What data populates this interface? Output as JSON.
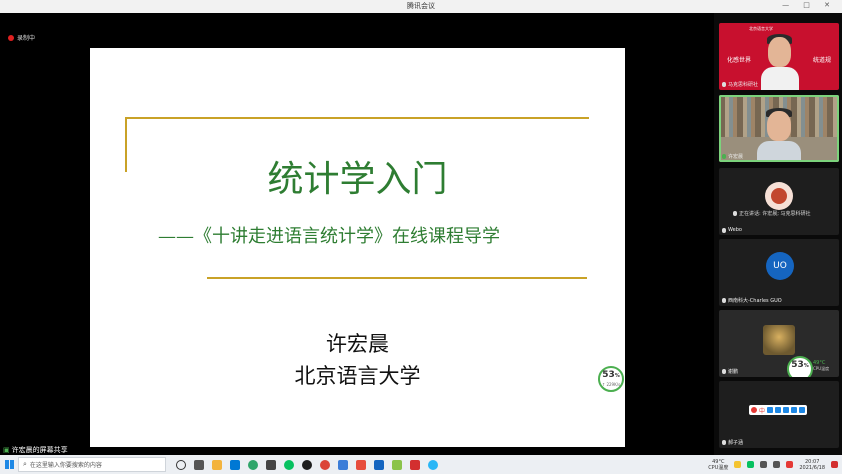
{
  "window": {
    "title": "腾讯会议",
    "controls": "— □ ✕"
  },
  "recording": {
    "label": "录制中"
  },
  "slide": {
    "title": "统计学入门",
    "subtitle": "——《十讲走进语言统计学》在线课程导学",
    "author": "许宏晨",
    "affiliation": "北京语言大学"
  },
  "net_meter_main": {
    "percent": "53",
    "unit": "%",
    "speed": "↑ 229K/s"
  },
  "share_status": {
    "label": "许宏晨的屏幕共享"
  },
  "participants": [
    {
      "name": "马克思科研社",
      "sign_left": "化感世界",
      "sign_right": "统道规",
      "logo_text": "北京语言大学"
    },
    {
      "name": "许宏晨"
    },
    {
      "name": "Webo",
      "speaking": "正在讲话: 许宏晨; 马克思科研社"
    },
    {
      "name": "西南科大-Charles GUO",
      "avatar": "UO"
    },
    {
      "name": "谢鹏",
      "meter_percent": "53",
      "meter_unit": "%",
      "cpu_temp": "49°C",
      "cpu_label": "CPU温度"
    },
    {
      "name": "郝子涵",
      "toolbar_text": "中"
    }
  ],
  "taskbar": {
    "search_placeholder": "在这里输入你要搜索的内容",
    "temp": "49°C",
    "temp_label": "CPU温度",
    "time": "20:07",
    "date": "2021/6/18"
  },
  "colors": {
    "slide_title": "#2e7d32",
    "gold_rule": "#c9a227",
    "tile_red": "#c8102e",
    "avatar_blue": "#1565c0",
    "active_frame": "#7cd37c"
  }
}
